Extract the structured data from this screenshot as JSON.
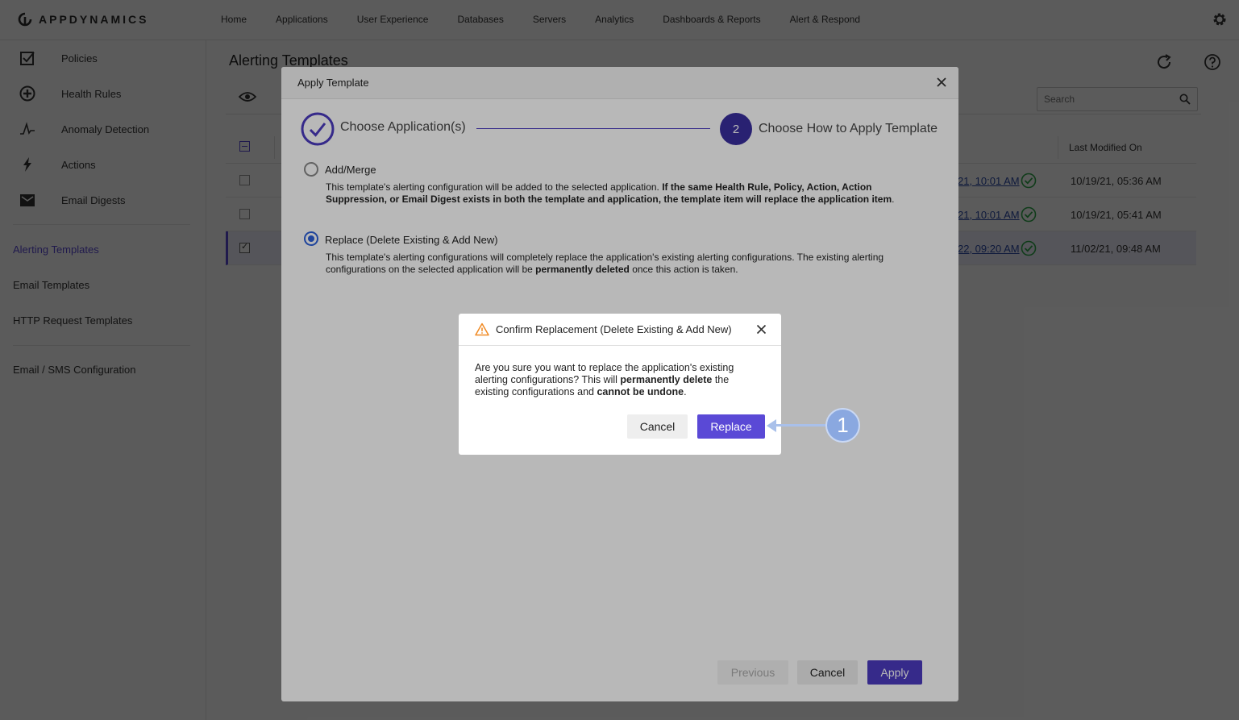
{
  "app": {
    "logo_text": "APPDYNAMICS"
  },
  "nav": {
    "items": [
      {
        "label": "Home"
      },
      {
        "label": "Applications"
      },
      {
        "label": "User Experience"
      },
      {
        "label": "Databases"
      },
      {
        "label": "Servers"
      },
      {
        "label": "Analytics"
      },
      {
        "label": "Dashboards & Reports"
      },
      {
        "label": "Alert & Respond"
      }
    ]
  },
  "sidebar": {
    "items": [
      {
        "label": "Policies",
        "icon": "checkbox-icon"
      },
      {
        "label": "Health Rules",
        "icon": "plus-circle-icon"
      },
      {
        "label": "Anomaly Detection",
        "icon": "anomaly-icon"
      },
      {
        "label": "Actions",
        "icon": "bolt-icon"
      },
      {
        "label": "Email Digests",
        "icon": "envelope-icon"
      }
    ],
    "links": [
      {
        "label": "Alerting Templates",
        "active": true
      },
      {
        "label": "Email Templates"
      },
      {
        "label": "HTTP Request Templates"
      },
      {
        "label": "Email / SMS Configuration"
      }
    ]
  },
  "main": {
    "title": "Alerting Templates",
    "search_placeholder": "Search",
    "columns": {
      "last_modified": "Last Modified On"
    },
    "rows": [
      {
        "link": "21, 10:01 AM",
        "last_modified": "10/19/21, 05:36 AM",
        "checked": false
      },
      {
        "link": "21, 10:01 AM",
        "last_modified": "10/19/21, 05:41 AM",
        "checked": false
      },
      {
        "link": "22, 09:20 AM",
        "last_modified": "11/02/21, 09:48 AM",
        "checked": true
      }
    ]
  },
  "apply_modal": {
    "title": "Apply Template",
    "step1_label": "Choose Application(s)",
    "step2_number": "2",
    "step2_label": "Choose How to Apply Template",
    "option_merge": {
      "label": "Add/Merge",
      "desc_plain": "This template's alerting configuration will be added to the selected application. ",
      "desc_bold": "If the same Health Rule, Policy, Action, Action Suppression, or Email Digest exists in both the template and application, the template item will replace the application item",
      "desc_end": "."
    },
    "option_replace": {
      "label": "Replace (Delete Existing & Add New)",
      "desc_plain": "This template's alerting configurations will completely replace the application's existing alerting configurations. The existing alerting configurations on the selected application will be ",
      "desc_bold": "permanently deleted",
      "desc_end": " once this action is taken."
    },
    "buttons": {
      "previous": "Previous",
      "cancel": "Cancel",
      "apply": "Apply"
    }
  },
  "confirm_dialog": {
    "title": "Confirm Replacement (Delete Existing & Add New)",
    "body_1": "Are you sure you want to replace the application's existing alerting configurations? This will ",
    "body_bold_1": "permanently delete",
    "body_2": " the existing configurations and ",
    "body_bold_2": "cannot be undone",
    "body_3": ".",
    "cancel": "Cancel",
    "replace": "Replace"
  },
  "callout": {
    "number": "1"
  },
  "colors": {
    "accent": "#5a49d6",
    "step_done": "#4b3bbf",
    "warning": "#f08a24",
    "success": "#2ea84a"
  }
}
